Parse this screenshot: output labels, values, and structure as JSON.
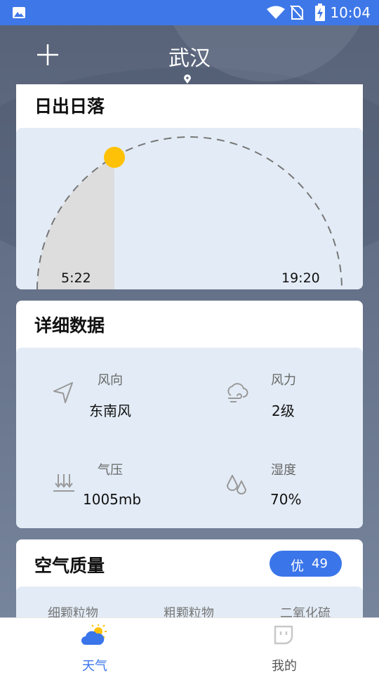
{
  "status_bar": {
    "time": "10:04"
  },
  "header": {
    "city": "武汉"
  },
  "sun_card": {
    "title": "日出日落",
    "sunrise": "5:22",
    "sunset": "19:20",
    "sun_color": "#ffc107"
  },
  "detail_card": {
    "title": "详细数据",
    "items": [
      {
        "label": "风向",
        "value": "东南风",
        "icon": "navigation-arrow-icon"
      },
      {
        "label": "风力",
        "value": "2级",
        "icon": "wind-cloud-icon"
      },
      {
        "label": "气压",
        "value": "1005mb",
        "icon": "pressure-icon"
      },
      {
        "label": "湿度",
        "value": "70%",
        "icon": "humidity-drops-icon"
      }
    ]
  },
  "air_card": {
    "title": "空气质量",
    "level": "优",
    "aqi": "49",
    "columns": [
      "细颗粒物",
      "粗颗粒物",
      "二氧化硫"
    ]
  },
  "tabs": [
    {
      "label": "天气",
      "icon": "weather-sun-cloud-icon",
      "active": true
    },
    {
      "label": "我的",
      "icon": "profile-face-icon",
      "active": false
    }
  ],
  "colors": {
    "accent": "#3a75ea",
    "status_bar": "#3e78e8",
    "inner_panel": "#e3ecf6"
  }
}
